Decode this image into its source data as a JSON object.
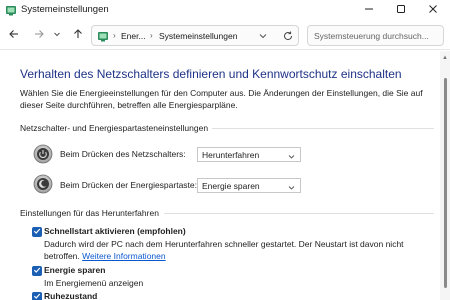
{
  "window": {
    "title": "Systemeinstellungen",
    "icon": "control-panel-icon"
  },
  "address_bar": {
    "crumbs": [
      "Ener...",
      "Systemeinstellungen"
    ],
    "separator": "›"
  },
  "search": {
    "placeholder": "Systemsteuerung durchsuch..."
  },
  "page": {
    "title": "Verhalten des Netzschalters definieren und Kennwortschutz einschalten",
    "description": "Wählen Sie die Energieeinstellungen für den Computer aus. Die Änderungen der Einstellungen, die Sie auf dieser Seite durchführen, betreffen alle Energiesparpläne."
  },
  "power_section": {
    "title": "Netzschalter- und Energiespartasteneinstellungen",
    "rows": [
      {
        "label": "Beim Drücken des Netzschalters:",
        "value": "Herunterfahren",
        "icon": "power-button-icon"
      },
      {
        "label": "Beim Drücken der Energiespartaste:",
        "value": "Energie sparen",
        "icon": "sleep-button-icon"
      }
    ]
  },
  "shutdown_section": {
    "title": "Einstellungen für das Herunterfahren",
    "options": [
      {
        "label": "Schnellstart aktivieren (empfohlen)",
        "checked": true,
        "description": "Dadurch wird der PC nach dem Herunterfahren schneller gestartet. Der Neustart ist davon nicht betroffen.",
        "link": "Weitere Informationen"
      },
      {
        "label": "Energie sparen",
        "checked": true,
        "description": "Im Energiemenü anzeigen"
      },
      {
        "label": "Ruhezustand",
        "checked": true
      }
    ]
  },
  "colors": {
    "title_blue": "#1e3287",
    "checkbox_blue": "#1a5fb4",
    "link_blue": "#0b57d0"
  }
}
